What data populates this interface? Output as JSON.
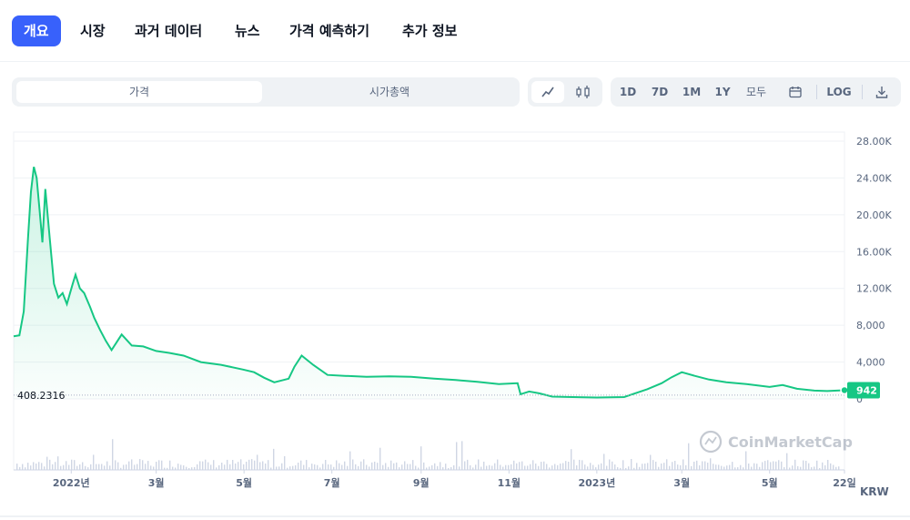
{
  "tabs": [
    {
      "label": "개요",
      "active": true
    },
    {
      "label": "시장"
    },
    {
      "label": "과거 데이터"
    },
    {
      "label": "뉴스"
    },
    {
      "label": "가격 예측하기"
    },
    {
      "label": "추가 정보"
    }
  ],
  "toggle": {
    "price": "가격",
    "market_cap": "시가총액"
  },
  "range_buttons": [
    "1D",
    "7D",
    "1M",
    "1Y",
    "모두"
  ],
  "log_label": "LOG",
  "icons": {
    "line": "line-chart-icon",
    "candle": "candlestick-icon",
    "calendar": "calendar-icon",
    "download": "download-icon"
  },
  "colors": {
    "accent": "#3861fb",
    "line": "#16c784",
    "badge": "#16c784"
  },
  "watermark": "CoinMarketCap",
  "currency": "KRW",
  "chart_data": {
    "type": "area",
    "y_ticks": [
      "28.00K",
      "24.00K",
      "20.00K",
      "16.00K",
      "12.00K",
      "8,000",
      "4,000",
      "0"
    ],
    "ylim": [
      0,
      28000
    ],
    "x_ticks": [
      "2022년",
      "3월",
      "5월",
      "7월",
      "9월",
      "11월",
      "2023년",
      "3월",
      "5월",
      "22일"
    ],
    "reference_line": {
      "label": "408.2316",
      "value": 408.2316
    },
    "current_price": {
      "label": "942",
      "value": 942
    },
    "series": [
      {
        "x": [
          "2021-11-22",
          "2021-11-26",
          "2021-11-29",
          "2021-12-02",
          "2021-12-04",
          "2021-12-06",
          "2021-12-08",
          "2021-12-10",
          "2021-12-12",
          "2021-12-14",
          "2021-12-17",
          "2021-12-20",
          "2021-12-23",
          "2021-12-26",
          "2021-12-29",
          "2022-01-02",
          "2022-01-04",
          "2022-01-07",
          "2022-01-10",
          "2022-01-14",
          "2022-01-17",
          "2022-01-21",
          "2022-01-25",
          "2022-01-29",
          "2022-02-05",
          "2022-02-12",
          "2022-02-20",
          "2022-03-01",
          "2022-03-10",
          "2022-03-20",
          "2022-04-01",
          "2022-04-15",
          "2022-04-30",
          "2022-05-08",
          "2022-05-15",
          "2022-05-22",
          "2022-06-01",
          "2022-06-05",
          "2022-06-10",
          "2022-06-18",
          "2022-06-28",
          "2022-07-10",
          "2022-07-25",
          "2022-08-10",
          "2022-08-25",
          "2022-09-10",
          "2022-09-25",
          "2022-10-10",
          "2022-10-25",
          "2022-11-07",
          "2022-11-09",
          "2022-11-15",
          "2022-11-22",
          "2022-12-01",
          "2022-12-15",
          "2023-01-01",
          "2023-01-20",
          "2023-02-05",
          "2023-02-15",
          "2023-02-22",
          "2023-03-01",
          "2023-03-10",
          "2023-03-20",
          "2023-04-01",
          "2023-04-15",
          "2023-05-01",
          "2023-05-10",
          "2023-05-20",
          "2023-06-01",
          "2023-06-10",
          "2023-06-22"
        ],
        "values": [
          6800,
          6900,
          9500,
          17500,
          22500,
          25200,
          24000,
          20500,
          17000,
          22800,
          17500,
          12500,
          11000,
          11500,
          10300,
          12500,
          13500,
          12000,
          11500,
          10000,
          8800,
          7500,
          6300,
          5300,
          7000,
          5800,
          5700,
          5200,
          5000,
          4700,
          4000,
          3700,
          3200,
          2900,
          2300,
          1800,
          2200,
          3500,
          4700,
          3700,
          2600,
          2500,
          2400,
          2450,
          2400,
          2200,
          2050,
          1850,
          1600,
          1700,
          500,
          800,
          600,
          250,
          200,
          150,
          200,
          1050,
          1700,
          2350,
          2900,
          2500,
          2100,
          1800,
          1600,
          1300,
          1500,
          1100,
          900,
          850,
          942
        ]
      }
    ]
  }
}
